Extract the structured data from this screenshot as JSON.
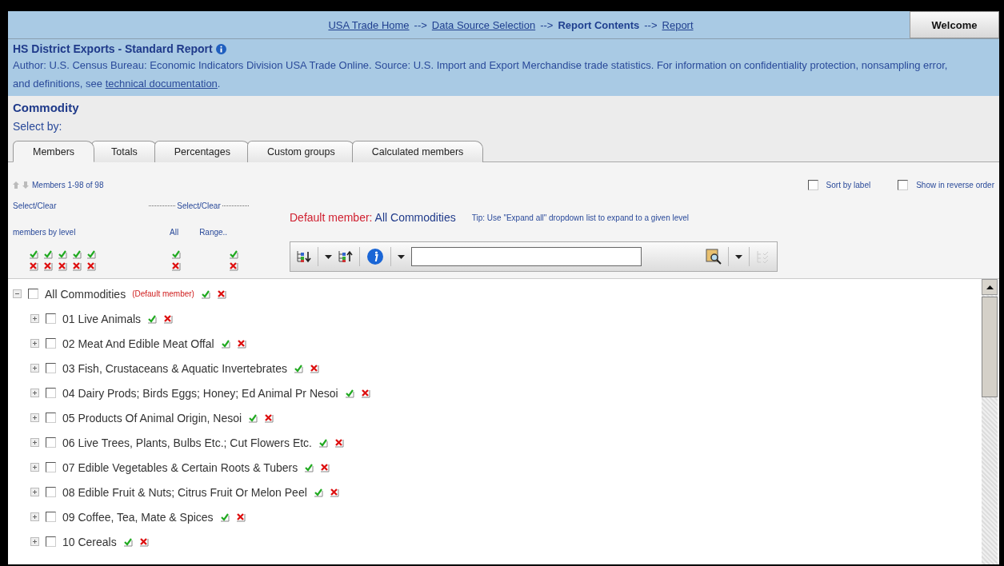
{
  "breadcrumb": [
    {
      "kind": "link",
      "text": "USA Trade Home"
    },
    {
      "kind": "separator",
      "text": "-->"
    },
    {
      "kind": "link",
      "text": "Data Source Selection"
    },
    {
      "kind": "separator",
      "text": "-->"
    },
    {
      "kind": "current",
      "text": "Report Contents"
    },
    {
      "kind": "separator",
      "text": "-->"
    },
    {
      "kind": "link",
      "text": "Report"
    }
  ],
  "welcome_button": "Welcome",
  "report": {
    "title": "HS District Exports - Standard Report",
    "description": "Author: U.S. Census Bureau: Economic Indicators Division USA Trade Online. Source: U.S. Import and Export Merchandise trade statistics. For information on confidentiality protection, nonsampling error, and definitions, see ",
    "link": "technical documentation",
    "after_link": "."
  },
  "section_title": "Commodity",
  "select_by": "Select by:",
  "tabs": [
    {
      "label": "Members",
      "selected": true
    },
    {
      "label": "Totals",
      "selected": false
    },
    {
      "label": "Percentages",
      "selected": false
    },
    {
      "label": "Custom groups",
      "selected": false
    },
    {
      "label": "Calculated members",
      "selected": false
    }
  ],
  "members_count": "Members 1-98 of 98",
  "options": [
    {
      "label": "Sort by label",
      "checked": false
    },
    {
      "label": "Show in reverse order",
      "checked": false
    }
  ],
  "select_clear": {
    "by_level_title": "Select/Clear",
    "by_level_sub": "members by level",
    "group_title": "Select/Clear",
    "all": "All",
    "range": "Range.."
  },
  "default_member": {
    "label": "Default member:",
    "value": "All Commodities"
  },
  "tip": "Tip: Use \"Expand all\" dropdown list to expand to a given level",
  "tree": {
    "label": "All Commodities",
    "note": "(Default member)",
    "expanded": true,
    "checked": false,
    "children": [
      {
        "label": "01 Live Animals",
        "expanded": false,
        "checked": false
      },
      {
        "label": "02 Meat And Edible Meat Offal",
        "expanded": false,
        "checked": false
      },
      {
        "label": "03 Fish, Crustaceans & Aquatic Invertebrates",
        "expanded": false,
        "checked": false
      },
      {
        "label": "04 Dairy Prods; Birds Eggs; Honey; Ed Animal Pr Nesoi",
        "expanded": false,
        "checked": false
      },
      {
        "label": "05 Products Of Animal Origin, Nesoi",
        "expanded": false,
        "checked": false
      },
      {
        "label": "06 Live Trees, Plants, Bulbs Etc.; Cut Flowers Etc.",
        "expanded": false,
        "checked": false
      },
      {
        "label": "07 Edible Vegetables & Certain Roots & Tubers",
        "expanded": false,
        "checked": false
      },
      {
        "label": "08 Edible Fruit & Nuts; Citrus Fruit Or Melon Peel",
        "expanded": false,
        "checked": false
      },
      {
        "label": "09 Coffee, Tea, Mate & Spices",
        "expanded": false,
        "checked": false
      },
      {
        "label": "10 Cereals",
        "expanded": false,
        "checked": false
      }
    ]
  }
}
